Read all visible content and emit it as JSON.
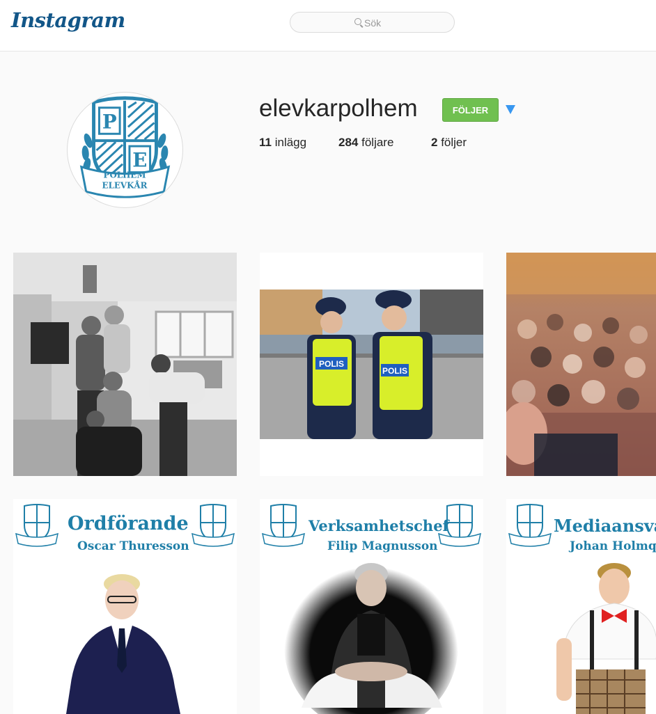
{
  "header": {
    "logo_text": "Instagram",
    "search_placeholder": "Sök"
  },
  "profile": {
    "username": "elevkarpolhem",
    "follow_label": "FÖLJER",
    "avatar_text_top": "POLHEM",
    "avatar_text_bottom": "ELEVKÅR",
    "stats": {
      "posts_count": "11",
      "posts_label": "inlägg",
      "followers_count": "284",
      "followers_label": "följare",
      "following_count": "2",
      "following_label": "följer"
    }
  },
  "posts": [
    {
      "kind": "photo",
      "icon": "group-photo"
    },
    {
      "kind": "photo",
      "icon": "police-photo",
      "badge_text": "POLIS"
    },
    {
      "kind": "photo",
      "icon": "crowd-photo"
    },
    {
      "kind": "poster",
      "title": "Ordförande",
      "name": "Oscar Thuresson"
    },
    {
      "kind": "poster",
      "title": "Verksamhetschef",
      "name": "Filip Magnusson"
    },
    {
      "kind": "poster",
      "title": "Mediaansva",
      "name": "Johan Holmqvis"
    }
  ],
  "colors": {
    "brand": "#125688",
    "follow_green": "#70c050",
    "arrow_blue": "#3897f0",
    "poster_blue": "#1f7fa8"
  }
}
